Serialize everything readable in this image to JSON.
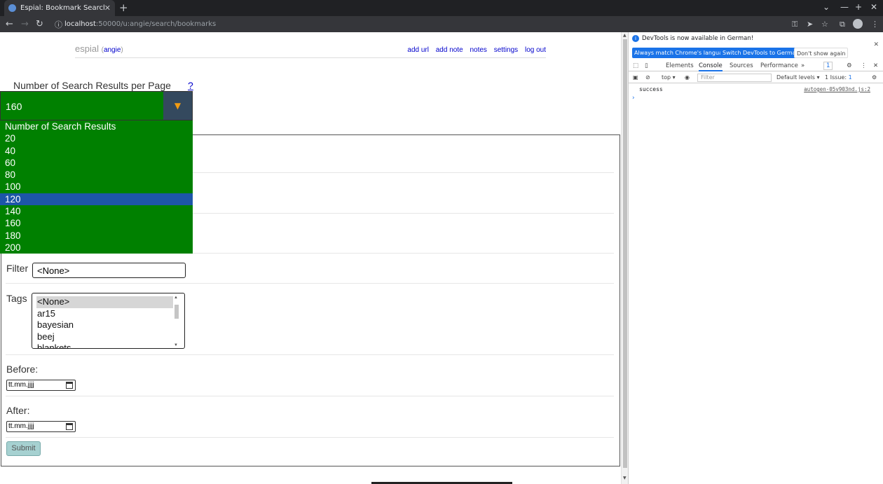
{
  "browser": {
    "tab_title": "Espial: Bookmark Search",
    "new_tab": "+",
    "url_host": "localhost",
    "url_path": ":50000/u:angie/search/bookmarks"
  },
  "nav": {
    "brand": "espial",
    "user": "angie",
    "links": [
      "add url",
      "add note",
      "notes",
      "settings",
      "log out"
    ]
  },
  "results_per_page": {
    "label": "Number of Search Results per Page",
    "help": "?",
    "selected": "160",
    "options": [
      "Number of Search Results",
      "20",
      "40",
      "60",
      "80",
      "100",
      "120",
      "140",
      "160",
      "180",
      "200"
    ],
    "highlighted": "120"
  },
  "form": {
    "filter_label": "Filter",
    "filter_value": "<None>",
    "tags_label": "Tags",
    "tags": [
      "<None>",
      "ar15",
      "bayesian",
      "beej",
      "blankets"
    ],
    "before_label": "Before:",
    "after_label": "After:",
    "date_placeholder": "tt.mm.jjjj",
    "submit": "Submit"
  },
  "devtools": {
    "notice": "DevTools is now available in German!",
    "btn_match": "Always match Chrome's language",
    "btn_switch": "Switch DevTools to German",
    "btn_dont": "Don't show again",
    "tabs": [
      "Elements",
      "Console",
      "Sources",
      "Performance"
    ],
    "active_tab": "Console",
    "more": "»",
    "msg_badge": "1",
    "context": "top",
    "filter_placeholder": "Filter",
    "levels": "Default levels",
    "issues": "1 Issue:",
    "issues_count": "1",
    "log_message": "success",
    "log_source": "autogen-05v903nd.js:2",
    "prompt": "›"
  }
}
